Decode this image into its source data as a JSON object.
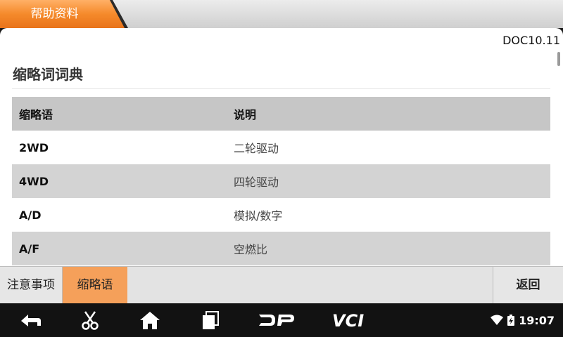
{
  "window": {
    "title": "帮助资料"
  },
  "document": {
    "id": "DOC10.11",
    "section_title": "缩略词词典",
    "columns": [
      "缩略语",
      "说明"
    ],
    "rows": [
      {
        "abbr": "2WD",
        "desc": "二轮驱动"
      },
      {
        "abbr": "4WD",
        "desc": "四轮驱动"
      },
      {
        "abbr": "A/D",
        "desc": "模拟/数字"
      },
      {
        "abbr": "A/F",
        "desc": "空燃比"
      }
    ]
  },
  "tabs": {
    "notes": "注意事项",
    "abbreviations": "缩略语",
    "back": "返回",
    "active": "abbreviations"
  },
  "navbar": {
    "icons": [
      "back-arrow-icon",
      "scissors-icon",
      "home-icon",
      "recent-apps-icon",
      "dp-logo-icon",
      "vci-logo-icon"
    ],
    "dp_label": "DP",
    "vci_label": "VCI"
  },
  "status": {
    "time": "19:07",
    "icons": [
      "wifi-icon",
      "battery-charging-icon"
    ]
  },
  "colors": {
    "accent": "#f58a2b",
    "active_tab": "#f5a05a",
    "header_row": "#c6c6c6",
    "shade_row": "#d3d3d3",
    "navbar": "#121212"
  }
}
